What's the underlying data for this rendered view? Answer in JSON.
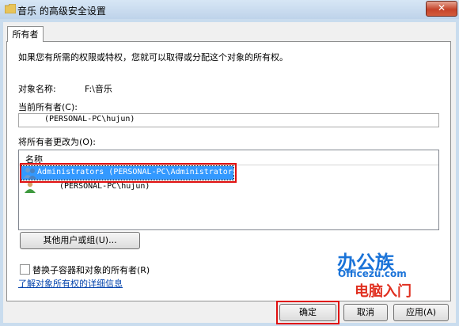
{
  "window": {
    "title": "音乐 的高级安全设置",
    "close_label": "✕"
  },
  "tabs": [
    {
      "label": "所有者"
    }
  ],
  "intro_text": "如果您有所需的权限或特权，您就可以取得或分配这个对象的所有权。",
  "object_name": {
    "label": "对象名称:",
    "value": "F:\\音乐"
  },
  "current_owner": {
    "label": "当前所有者(C):",
    "value": "(PERSONAL-PC\\hujun)"
  },
  "change_owner": {
    "label": "将所有者更改为(O):",
    "column_header": "名称",
    "items": [
      {
        "label": "Administrators (PERSONAL-PC\\Administrators)",
        "selected": true,
        "icon": "group-icon"
      },
      {
        "label": "(PERSONAL-PC\\hujun)",
        "selected": false,
        "icon": "user-icon"
      }
    ]
  },
  "other_users_button": "其他用户或组(U)...",
  "replace_checkbox": {
    "label": "替换子容器和对象的所有者(R)",
    "checked": false
  },
  "learn_more_link": "了解对象所有权的详细信息",
  "buttons": {
    "ok": "确定",
    "cancel": "取消",
    "apply": "应用(A)"
  },
  "watermark": {
    "brand_cn": "办公族",
    "brand_en": "Officezu.com",
    "subtitle": "电脑入门"
  },
  "colors": {
    "selection": "#3399ff",
    "highlight_border": "#e01010",
    "link": "#0645ad"
  }
}
